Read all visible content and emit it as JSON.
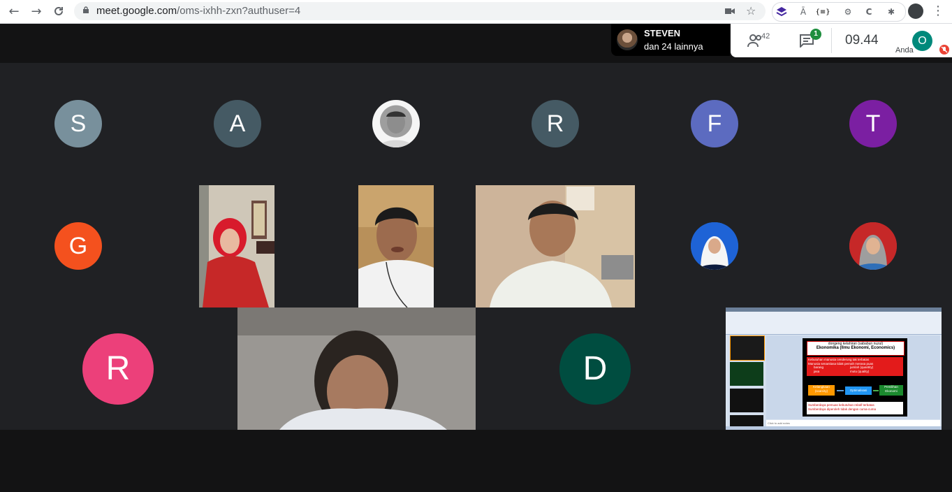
{
  "browser": {
    "url_host": "meet.google.com",
    "url_path": "/oms-ixhh-zxn?authuser=4",
    "back_icon": "arrow-left-icon",
    "forward_icon": "arrow-right-icon",
    "reload_icon": "reload-icon"
  },
  "meeting": {
    "speaker_name": "STEVEN",
    "speaker_sub": "dan 24 lainnya",
    "participants_count": "42",
    "chat_badge": "1",
    "time": "09.44",
    "self_initial": "O",
    "self_label": "Anda"
  },
  "tiles": {
    "r1": [
      "S",
      "A",
      "R",
      "F",
      "T"
    ],
    "g": "G",
    "big_r": "R",
    "big_d": "D"
  },
  "slide": {
    "title": "dongeng kelahiran  (sababun nuzul)",
    "subtitle": "Ekonomika (Ilmu Ekonomi, Economics)",
    "line1": "Kebutuhan manusia cenderung tak terbatas",
    "line2": "Manusia senantiasa tidak pernah merasa puas",
    "line3a": "barang",
    "line3b": "jumlah (quantity)",
    "line4a": "jasa",
    "line4b": "mutu (quality)",
    "box1": "Kelangkaan (scarcity)",
    "box2": "Optimalisasi",
    "box3": "Pemilihan Ekonomi",
    "bottom1": "Sumberdaya pemuas kebutuhan relatif terbatas",
    "bottom2": "Sumberdaya diperoleh tidak dengan cuma-cuma",
    "notes": "Click to add notes"
  },
  "colors": {
    "s": "#78909c",
    "a": "#455a64",
    "r": "#455a64",
    "f": "#5c6bc0",
    "t": "#7b1fa2",
    "g": "#f4511e",
    "big_r": "#ec407a",
    "big_d": "#004d40"
  }
}
